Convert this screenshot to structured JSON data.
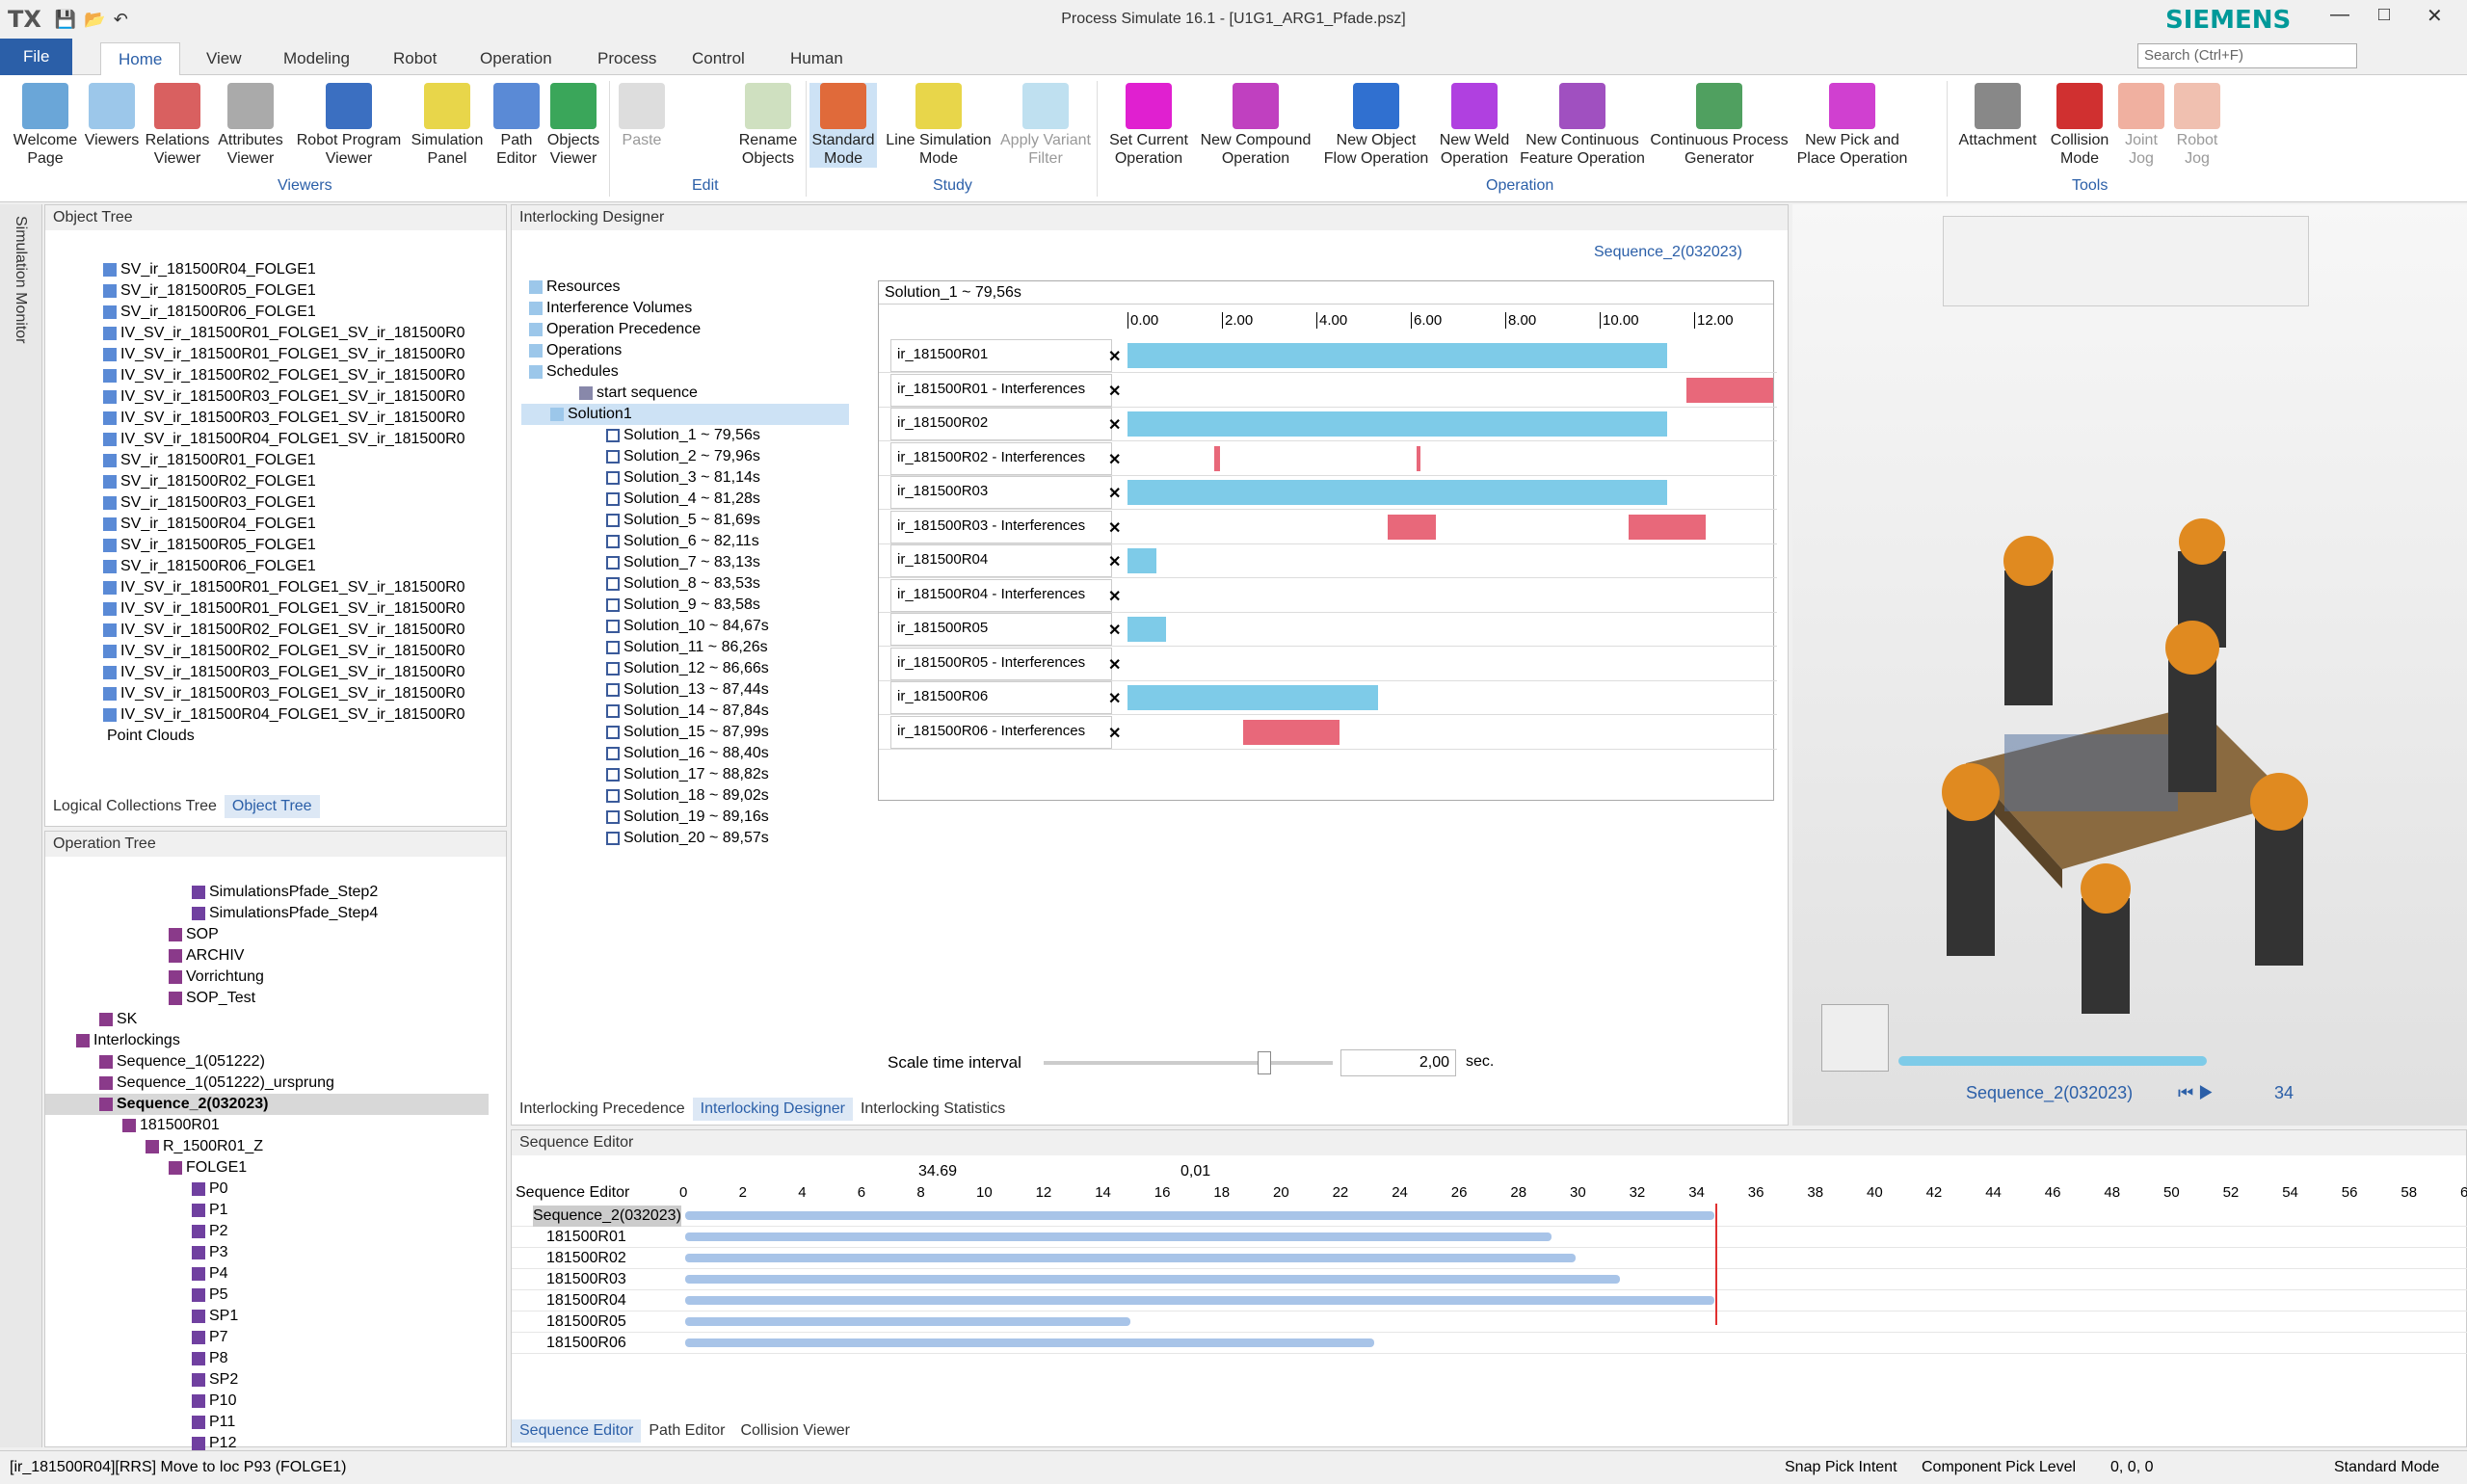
{
  "app": {
    "logo": "TX",
    "title": "Process Simulate 16.1 - [U1G1_ARG1_Pfade.psz]",
    "brand": "SIEMENS",
    "search_placeholder": "Search (Ctrl+F)"
  },
  "tabs": [
    "File",
    "Home",
    "View",
    "Modeling",
    "Robot",
    "Operation",
    "Process",
    "Control",
    "Human"
  ],
  "ribbon": {
    "viewers": [
      "Welcome Page",
      "Viewers",
      "Relations Viewer",
      "Attributes Viewer",
      "Robot Program Viewer",
      "Simulation Panel",
      "Path Editor",
      "Objects Viewer"
    ],
    "edit": [
      "Paste",
      "Rename Objects"
    ],
    "study": [
      "Standard Mode",
      "Line Simulation Mode",
      "Apply Variant Filter"
    ],
    "operation": [
      "Set Current Operation",
      "New Compound Operation",
      "New Object Flow Operation",
      "New Weld Operation",
      "New Continuous Feature Operation",
      "Continuous Process Generator",
      "New Pick and Place Operation"
    ],
    "tools": [
      "Attachment",
      "Collision Mode",
      "Joint Jog",
      "Robot Jog"
    ],
    "groups": [
      "Viewers",
      "Edit",
      "Study",
      "Operation",
      "Tools"
    ]
  },
  "side_tab": "Simulation Monitor",
  "object_tree": {
    "title": "Object Tree",
    "items": [
      "SV_ir_181500R04_FOLGE1",
      "SV_ir_181500R05_FOLGE1",
      "SV_ir_181500R06_FOLGE1",
      "IV_SV_ir_181500R01_FOLGE1_SV_ir_181500R0",
      "IV_SV_ir_181500R01_FOLGE1_SV_ir_181500R0",
      "IV_SV_ir_181500R02_FOLGE1_SV_ir_181500R0",
      "IV_SV_ir_181500R03_FOLGE1_SV_ir_181500R0",
      "IV_SV_ir_181500R03_FOLGE1_SV_ir_181500R0",
      "IV_SV_ir_181500R04_FOLGE1_SV_ir_181500R0",
      "SV_ir_181500R01_FOLGE1",
      "SV_ir_181500R02_FOLGE1",
      "SV_ir_181500R03_FOLGE1",
      "SV_ir_181500R04_FOLGE1",
      "SV_ir_181500R05_FOLGE1",
      "SV_ir_181500R06_FOLGE1",
      "IV_SV_ir_181500R01_FOLGE1_SV_ir_181500R0",
      "IV_SV_ir_181500R01_FOLGE1_SV_ir_181500R0",
      "IV_SV_ir_181500R02_FOLGE1_SV_ir_181500R0",
      "IV_SV_ir_181500R02_FOLGE1_SV_ir_181500R0",
      "IV_SV_ir_181500R03_FOLGE1_SV_ir_181500R0",
      "IV_SV_ir_181500R03_FOLGE1_SV_ir_181500R0",
      "IV_SV_ir_181500R04_FOLGE1_SV_ir_181500R0"
    ],
    "last": "Point Clouds",
    "tabs": [
      "Logical Collections Tree",
      "Object Tree"
    ]
  },
  "operation_tree": {
    "title": "Operation Tree",
    "items": [
      {
        "t": "SimulationsPfade_Step2",
        "d": 6
      },
      {
        "t": "SimulationsPfade_Step4",
        "d": 6
      },
      {
        "t": "SOP",
        "d": 5
      },
      {
        "t": "ARCHIV",
        "d": 5
      },
      {
        "t": "Vorrichtung",
        "d": 5
      },
      {
        "t": "SOP_Test",
        "d": 5
      },
      {
        "t": "SK",
        "d": 2
      },
      {
        "t": "Interlockings",
        "d": 1
      },
      {
        "t": "Sequence_1(051222)",
        "d": 2
      },
      {
        "t": "Sequence_1(051222)_ursprung",
        "d": 2
      },
      {
        "t": "Sequence_2(032023)",
        "d": 2
      },
      {
        "t": "181500R01",
        "d": 3
      },
      {
        "t": "R_1500R01_Z",
        "d": 4
      },
      {
        "t": "FOLGE1",
        "d": 5
      },
      {
        "t": "P0",
        "d": 6
      },
      {
        "t": "P1",
        "d": 6
      },
      {
        "t": "P2",
        "d": 6
      },
      {
        "t": "P3",
        "d": 6
      },
      {
        "t": "P4",
        "d": 6
      },
      {
        "t": "P5",
        "d": 6
      },
      {
        "t": "SP1",
        "d": 6
      },
      {
        "t": "P7",
        "d": 6
      },
      {
        "t": "P8",
        "d": 6
      },
      {
        "t": "SP2",
        "d": 6
      },
      {
        "t": "P10",
        "d": 6
      },
      {
        "t": "P11",
        "d": 6
      },
      {
        "t": "P12",
        "d": 6
      }
    ]
  },
  "interlocking": {
    "title": "Interlocking Designer",
    "header": "Sequence_2(032023)",
    "tree": [
      "Resources",
      "Interference Volumes",
      "Operation Precedence",
      "Operations",
      "Schedules",
      "start sequence",
      "Solution1"
    ],
    "solutions": [
      "Solution_1 ~ 79,56s",
      "Solution_2 ~ 79,96s",
      "Solution_3 ~ 81,14s",
      "Solution_4 ~ 81,28s",
      "Solution_5 ~ 81,69s",
      "Solution_6 ~ 82,11s",
      "Solution_7 ~ 83,13s",
      "Solution_8 ~ 83,53s",
      "Solution_9 ~ 83,58s",
      "Solution_10 ~ 84,67s",
      "Solution_11 ~ 86,26s",
      "Solution_12 ~ 86,66s",
      "Solution_13 ~ 87,44s",
      "Solution_14 ~ 87,84s",
      "Solution_15 ~ 87,99s",
      "Solution_16 ~ 88,40s",
      "Solution_17 ~ 88,82s",
      "Solution_18 ~ 89,02s",
      "Solution_19 ~ 89,16s",
      "Solution_20 ~ 89,57s"
    ],
    "gantt_title": "Solution_1 ~ 79,56s",
    "ticks": [
      "0.00",
      "2.00",
      "4.00",
      "6.00",
      "8.00",
      "10.00",
      "12.00"
    ],
    "rows": [
      "ir_181500R01",
      "ir_181500R01 - Interferences",
      "ir_181500R02",
      "ir_181500R02 - Interferences",
      "ir_181500R03",
      "ir_181500R03 - Interferences",
      "ir_181500R04",
      "ir_181500R04 - Interferences",
      "ir_181500R05",
      "ir_181500R05 - Interferences",
      "ir_181500R06",
      "ir_181500R06 - Interferences"
    ],
    "scale_label": "Scale time interval",
    "scale_value": "2,00",
    "scale_unit": "sec.",
    "tabs": [
      "Interlocking Precedence",
      "Interlocking Designer",
      "Interlocking Statistics"
    ]
  },
  "viewer": {
    "sequence": "Sequence_2(032023)",
    "frame": "34"
  },
  "sequence_editor": {
    "title": "Sequence Editor",
    "time": "34.69",
    "step": "0,01",
    "col": "Sequence Editor",
    "rows": [
      "Sequence_2(032023)",
      "181500R01",
      "181500R02",
      "181500R03",
      "181500R04",
      "181500R05",
      "181500R06"
    ],
    "bars": [
      34.69,
      29.2,
      30.0,
      31.5,
      34.69,
      15.0,
      23.2
    ],
    "ticks": [
      "0",
      "2",
      "4",
      "6",
      "8",
      "10",
      "12",
      "14",
      "16",
      "18",
      "20",
      "22",
      "24",
      "26",
      "28",
      "30",
      "32",
      "34",
      "36",
      "38",
      "40",
      "42",
      "44",
      "46",
      "48",
      "50",
      "52",
      "54",
      "56",
      "58",
      "6"
    ],
    "tabs": [
      "Sequence Editor",
      "Path Editor",
      "Collision Viewer"
    ]
  },
  "status": {
    "left": "[ir_181500R04][RRS] Move to loc P93 (FOLGE1)",
    "snap": "Snap Pick Intent",
    "comp": "Component Pick Level",
    "coords": "0, 0, 0",
    "mode": "Standard Mode"
  }
}
